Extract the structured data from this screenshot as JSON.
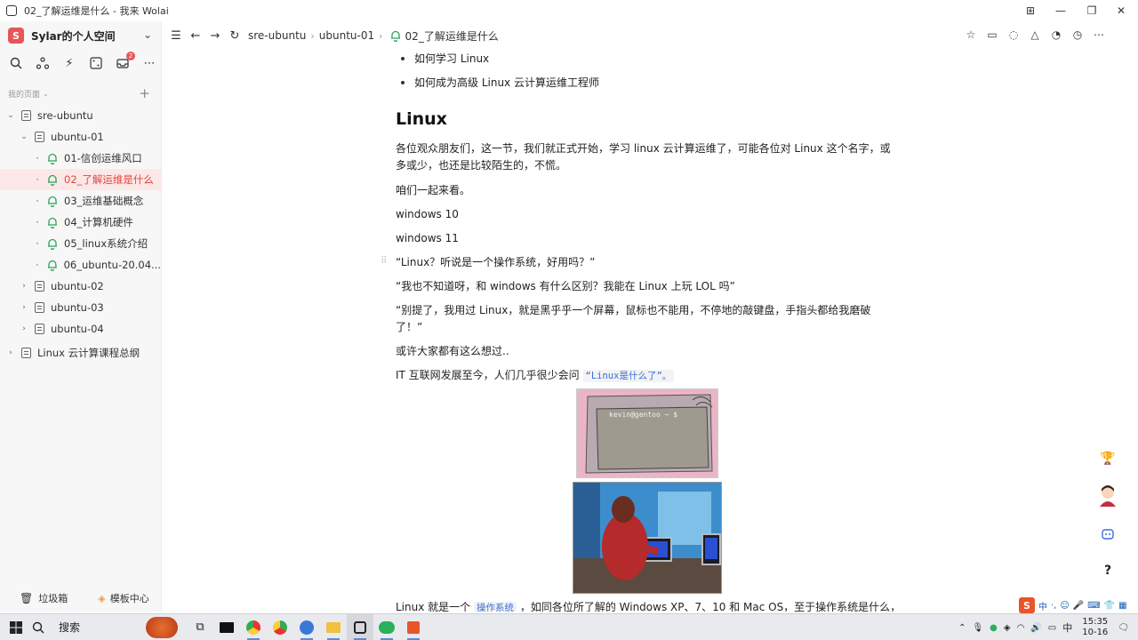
{
  "window": {
    "title": "02_了解运维是什么 - 我来 Wolai"
  },
  "sidebar": {
    "workspace_badge": "S",
    "workspace_name": "Sylar的个人空间",
    "notification_count": "2",
    "section_title": "我的页面",
    "tree": [
      {
        "label": "sre-ubuntu",
        "level": 0,
        "type": "doc",
        "expanded": true
      },
      {
        "label": "ubuntu-01",
        "level": 1,
        "type": "doc",
        "expanded": true
      },
      {
        "label": "01-信创运维风口",
        "level": 2,
        "type": "bell"
      },
      {
        "label": "02_了解运维是什么",
        "level": 2,
        "type": "bell",
        "active": true
      },
      {
        "label": "03_运维基础概念",
        "level": 2,
        "type": "bell"
      },
      {
        "label": "04_计算机硬件",
        "level": 2,
        "type": "bell"
      },
      {
        "label": "05_linux系统介绍",
        "level": 2,
        "type": "bell"
      },
      {
        "label": "06_ubuntu-20.04...",
        "level": 2,
        "type": "bell"
      },
      {
        "label": "ubuntu-02",
        "level": 1,
        "type": "doc",
        "expanded": false
      },
      {
        "label": "ubuntu-03",
        "level": 1,
        "type": "doc",
        "expanded": false
      },
      {
        "label": "ubuntu-04",
        "level": 1,
        "type": "doc",
        "expanded": false
      },
      {
        "label": "Linux 云计算课程总纲",
        "level": 0,
        "type": "doc",
        "expanded": false
      }
    ],
    "trash_label": "垃圾箱",
    "template_label": "模板中心"
  },
  "breadcrumb": [
    "sre-ubuntu",
    "ubuntu-01",
    "02_了解运维是什么"
  ],
  "content": {
    "bullets": [
      "如何学习 Linux",
      "如何成为高级 Linux 云计算运维工程师"
    ],
    "heading": "Linux",
    "para1": "各位观众朋友们，这一节，我们就正式开始，学习 linux 云计算运维了，可能各位对 Linux 这个名字，或多或少，也还是比较陌生的，不慌。",
    "para2": "咱们一起来看。",
    "para3": "windows 10",
    "para4": "windows 11",
    "quote1": "“Linux？听说是一个操作系统，好用吗？”",
    "quote2": "“我也不知道呀，和 windows 有什么区别？我能在 Linux 上玩 LOL 吗”",
    "quote3": "“别提了，我用过 Linux，就是黑乎乎一个屏幕，鼠标也不能用，不停地的敲键盘，手指头都给我磨破了！”",
    "para5": "或许大家都有这么想过..",
    "para6_prefix": "IT 互联网发展至今，人们几乎很少会问",
    "para6_code": "“Linux是什么了”。",
    "terminal_text": "kevin@gentoo ~ $",
    "para7_prefix": "Linux 就是一个",
    "para7_code": "操作系统",
    "para7_suffix": "，如同各位所了解的 Windows XP、7、10 和 Mac OS，至于操作系统是什么，"
  },
  "taskbar": {
    "search_label": "搜索",
    "time": "15:35",
    "date": "10-16",
    "ime": "中"
  },
  "colors": {
    "accent": "#e0463f",
    "active_bg": "#fde8e8",
    "link": "#3a6fd9"
  }
}
